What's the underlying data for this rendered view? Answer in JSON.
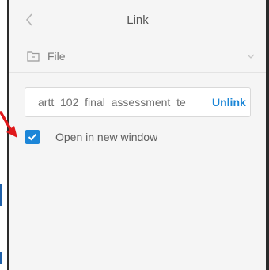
{
  "header": {
    "title": "Link",
    "back_icon": "chevron-left-icon"
  },
  "file_select": {
    "label": "File",
    "icon": "folder-icon",
    "dropdown_icon": "chevron-down-icon"
  },
  "link": {
    "url": "artt_102_final_assessment_te",
    "unlink_label": "Unlink"
  },
  "options": {
    "open_new_window_label": "Open in new window",
    "open_new_window_checked": true
  },
  "colors": {
    "accent": "#1d86d8",
    "annotation_arrow": "#e0191c"
  }
}
